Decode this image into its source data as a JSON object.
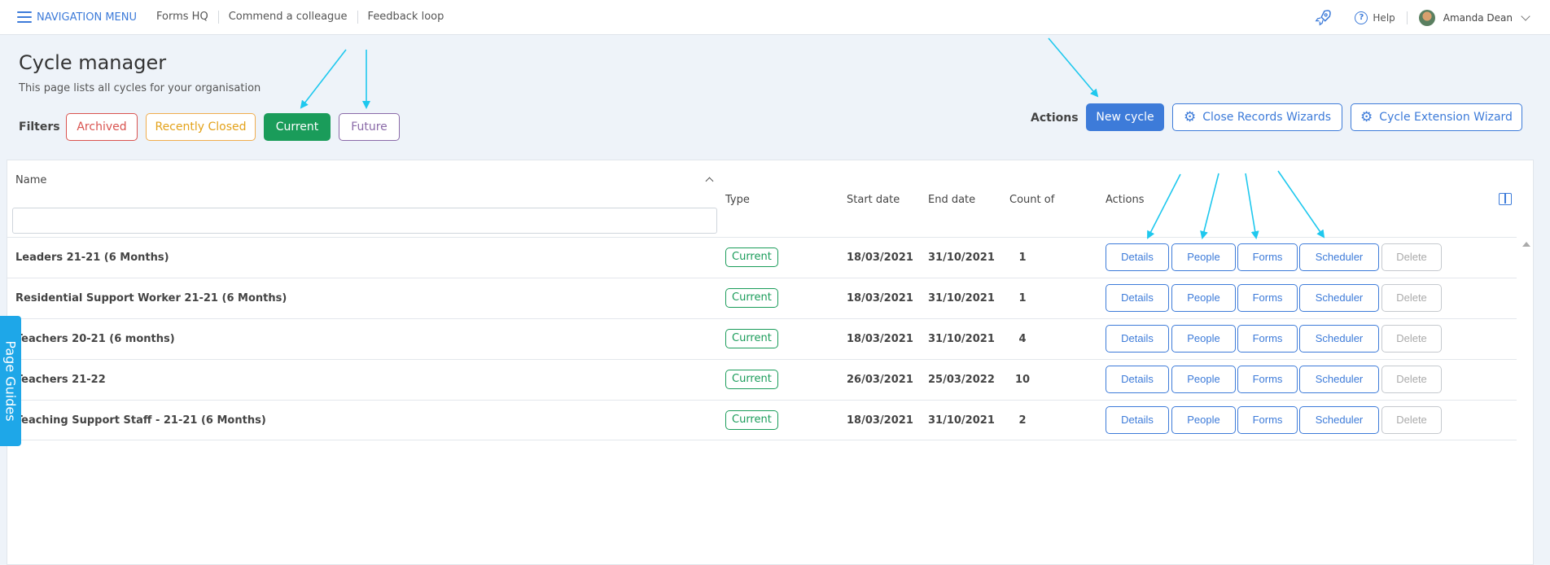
{
  "topbar": {
    "nav_menu": "NAVIGATION MENU",
    "links": [
      "Forms HQ",
      "Commend a colleague",
      "Feedback loop"
    ],
    "help": "Help",
    "user_name": "Amanda Dean"
  },
  "page": {
    "title": "Cycle manager",
    "subtitle": "This page lists all cycles for your organisation"
  },
  "filters": {
    "label": "Filters",
    "archived": "Archived",
    "recently_closed": "Recently Closed",
    "current": "Current",
    "future": "Future"
  },
  "actions": {
    "label": "Actions",
    "new_cycle": "New cycle",
    "close_records": "Close Records Wizards",
    "cycle_extension": "Cycle Extension Wizard"
  },
  "table": {
    "headers": {
      "name": "Name",
      "type": "Type",
      "start_date": "Start date",
      "end_date": "End date",
      "count": "Count of",
      "actions": "Actions"
    },
    "row_buttons": {
      "details": "Details",
      "people": "People",
      "forms": "Forms",
      "scheduler": "Scheduler",
      "delete": "Delete"
    },
    "rows": [
      {
        "name": "Leaders 21-21 (6 Months)",
        "type": "Current",
        "start": "18/03/2021",
        "end": "31/10/2021",
        "count": "1"
      },
      {
        "name": "Residential Support Worker 21-21 (6 Months)",
        "type": "Current",
        "start": "18/03/2021",
        "end": "31/10/2021",
        "count": "1"
      },
      {
        "name": "Teachers 20-21 (6 months)",
        "type": "Current",
        "start": "18/03/2021",
        "end": "31/10/2021",
        "count": "4"
      },
      {
        "name": "Teachers 21-22",
        "type": "Current",
        "start": "26/03/2021",
        "end": "25/03/2022",
        "count": "10"
      },
      {
        "name": "Teaching Support Staff - 21-21 (6 Months)",
        "type": "Current",
        "start": "18/03/2021",
        "end": "31/10/2021",
        "count": "2"
      }
    ]
  },
  "page_guides": "Page Guides",
  "colors": {
    "primary": "#3d7bd9",
    "current_green": "#1a9c5a",
    "archived_red": "#d9534f",
    "recent_orange": "#e3a21a",
    "future_purple": "#8a6aa8",
    "guides_blue": "#1ea7e8",
    "annotation_arrow": "#1ec8ee"
  }
}
